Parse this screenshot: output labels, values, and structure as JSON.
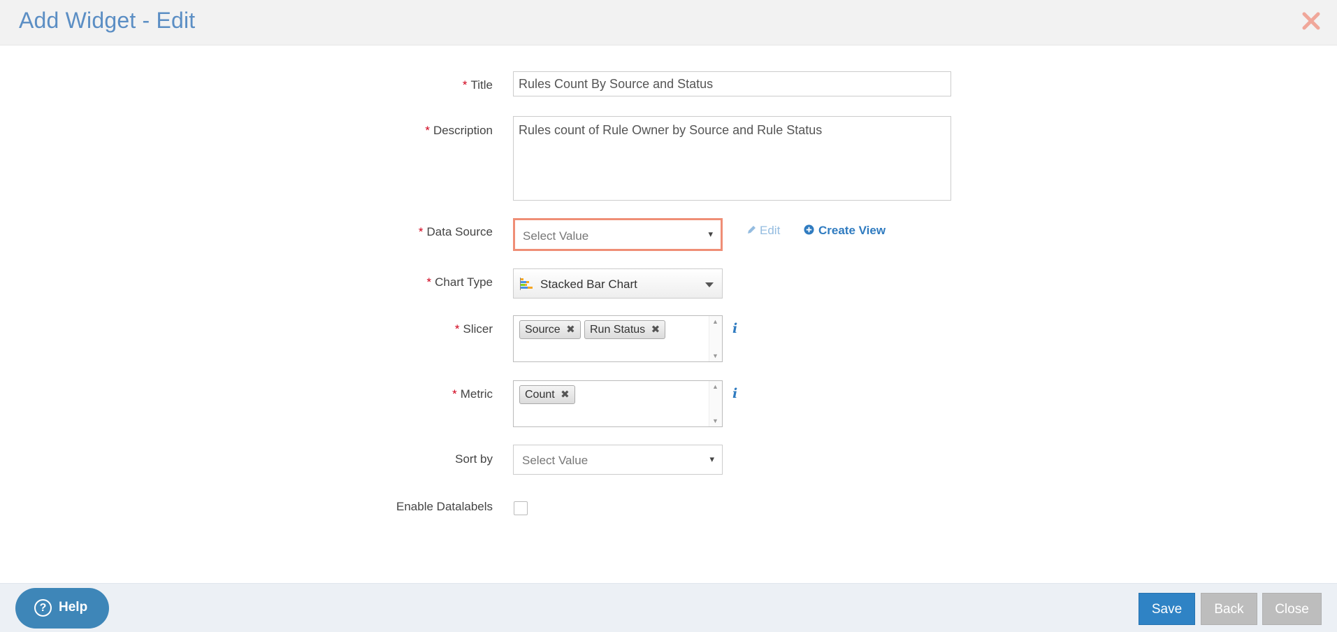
{
  "header": {
    "title": "Add Widget - Edit"
  },
  "form": {
    "required_marker": "*",
    "title": {
      "label": "Title",
      "value": "Rules Count By Source and Status"
    },
    "description": {
      "label": "Description",
      "value": "Rules count of Rule Owner by Source and Rule Status"
    },
    "data_source": {
      "label": "Data Source",
      "value": "Select Value",
      "edit_label": "Edit",
      "create_view_label": "Create View"
    },
    "chart_type": {
      "label": "Chart Type",
      "value": "Stacked Bar Chart"
    },
    "slicer": {
      "label": "Slicer",
      "tags": [
        "Source",
        "Run Status"
      ]
    },
    "metric": {
      "label": "Metric",
      "tags": [
        "Count"
      ]
    },
    "sort_by": {
      "label": "Sort by",
      "value": "Select Value"
    },
    "datalabels": {
      "label": "Enable Datalabels",
      "checked": false
    }
  },
  "footer": {
    "help_label": "Help",
    "save_label": "Save",
    "back_label": "Back",
    "close_label": "Close"
  },
  "colors": {
    "accent": "#2f83c5",
    "title": "#5b8ec4",
    "error_border": "#ef8e76",
    "required": "#d0021b",
    "close_icon": "#f0a79a"
  }
}
